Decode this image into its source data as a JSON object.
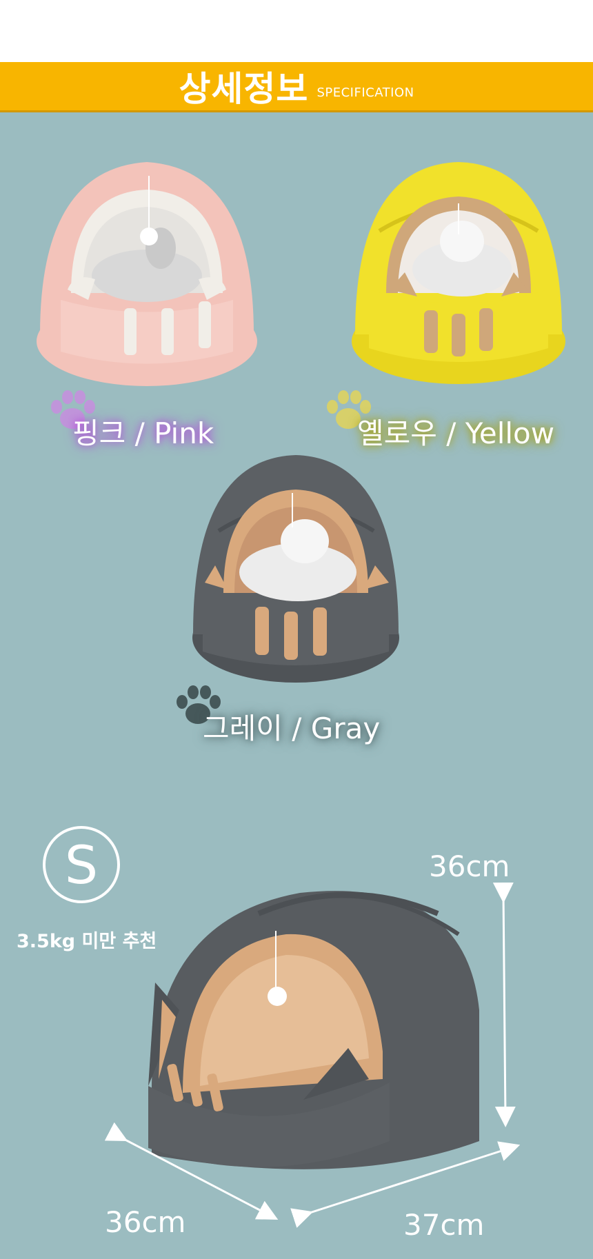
{
  "header": {
    "title": "상세정보",
    "subtitle": "SPECIFICATION"
  },
  "colors": [
    {
      "label": "핑크 / Pink",
      "paw_color": "#c98be0",
      "glow": "#b24fd8",
      "body": "#f3c3ba",
      "trim": "#f1eee8"
    },
    {
      "label": "옐로우 / Yellow",
      "paw_color": "#e2d35a",
      "glow": "#a7a217",
      "body": "#f1e12b",
      "trim": "#cfa77a"
    },
    {
      "label": "그레이 / Gray",
      "paw_color": "#46585a",
      "glow": "#4a6062",
      "body": "#5c6064",
      "trim": "#d9a97d"
    }
  ],
  "size": {
    "badge": "S",
    "note": "3.5kg 미만 추천",
    "height": "36cm",
    "depth": "36cm",
    "width": "37cm"
  },
  "theme": {
    "background": "#9bbcc0",
    "banner": "#f8b500"
  }
}
